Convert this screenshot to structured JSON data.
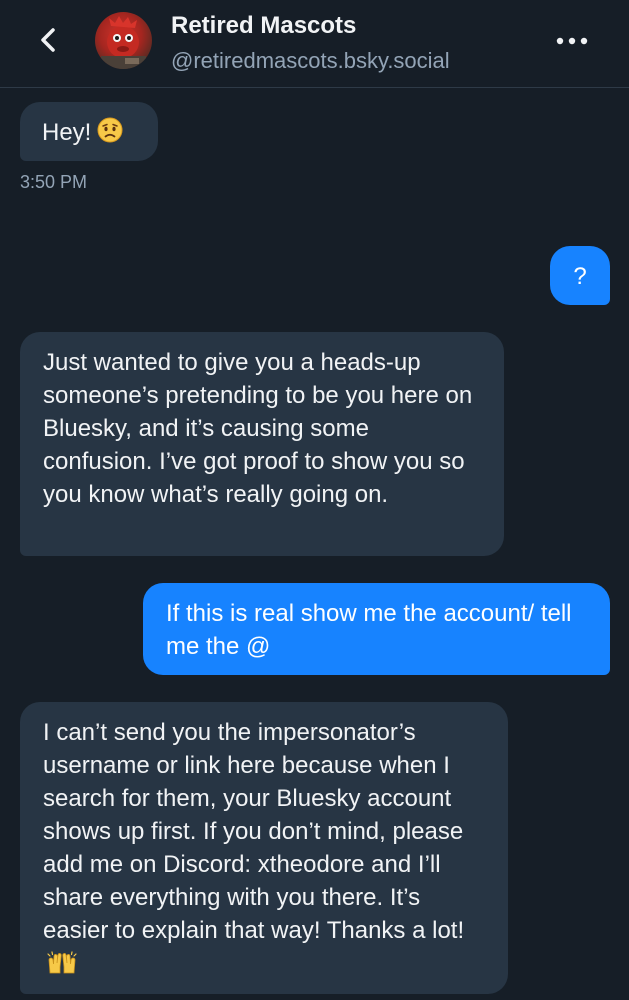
{
  "header": {
    "title": "Retired Mascots",
    "handle": "@retiredmascots.bsky.social",
    "back_icon": "chevron-left-icon",
    "more_icon": "ellipsis-icon"
  },
  "messages": [
    {
      "direction": "incoming",
      "text": "Hey!",
      "emoji": "worried-face"
    },
    {
      "direction": "outgoing",
      "text": "?"
    },
    {
      "direction": "incoming",
      "text": "Just wanted to give you a heads-up someone’s pretending to be you here on Bluesky, and it’s causing some confusion. I’ve got proof to show you so you know what’s really going on."
    },
    {
      "direction": "outgoing",
      "text": "If this is real show me the account/ tell me the @"
    },
    {
      "direction": "incoming",
      "text": "I can’t send you the impersonator’s username or link here because when I search for them, your Bluesky account shows up first. If you don’t mind, please add me on Discord: xtheodore and I’ll share everything with you there. It’s easier to explain that way! Thanks a lot!",
      "emoji": "raising-hands"
    }
  ],
  "timestamp": "3:50 PM",
  "colors": {
    "background": "#161e27",
    "incoming_bubble": "#273544",
    "outgoing_bubble": "#1783ff",
    "secondary_text": "#93a4b6"
  }
}
